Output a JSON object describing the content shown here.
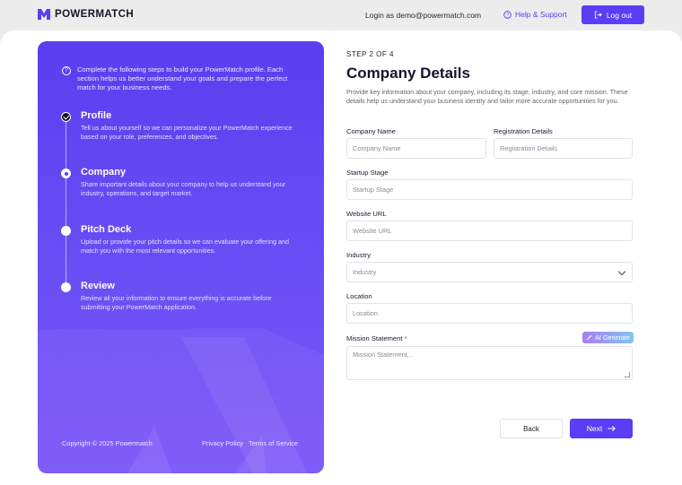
{
  "header": {
    "brand": "POWERMATCH",
    "login_prefix": "Login as",
    "login_email": "demo@powermatch.com",
    "help_label": "Help & Support",
    "logout_label": "Log out"
  },
  "colors": {
    "accent": "#5b3df5",
    "panel_top": "#5a3ef0",
    "panel_bottom": "#7a55f8"
  },
  "sidebar": {
    "intro": "Complete the following steps to build your PowerMatch profile. Each section helps us better understand your goals and prepare the perfect match for your business needs.",
    "steps": [
      {
        "title": "Profile",
        "desc": "Tell us about yourself so we can personalize your PowerMatch experience based on your role, preferences, and objectives.",
        "state": "completed"
      },
      {
        "title": "Company",
        "desc": "Share important details about your company to help us understand your industry, operations, and target market.",
        "state": "current"
      },
      {
        "title": "Pitch Deck",
        "desc": "Upload or provide your pitch details so we can evaluate your offering and match you with the most relevant opportunities.",
        "state": "upcoming"
      },
      {
        "title": "Review",
        "desc": "Review all your information to ensure everything is accurate before submitting your PowerMatch application.",
        "state": "upcoming"
      }
    ],
    "copyright": "Copyright © 2025 Powermatch",
    "privacy": "Privacy Policy",
    "terms": "Terms of Service"
  },
  "form": {
    "step_label": "STEP 2 OF 4",
    "title": "Company Details",
    "description": "Provide key information about your company, including its stage, industry, and core mission. These details help us understand your business identity and tailor more accurate opportunities for you.",
    "fields": {
      "company_name": {
        "label": "Company Name",
        "placeholder": "Company Name"
      },
      "registration": {
        "label": "Registration Details",
        "placeholder": "Registration Details"
      },
      "startup_stage": {
        "label": "Startup Stage",
        "placeholder": "Startup Stage"
      },
      "website": {
        "label": "Website URL",
        "placeholder": "Website URL"
      },
      "industry": {
        "label": "Industry",
        "placeholder": "Industry"
      },
      "location": {
        "label": "Location",
        "placeholder": "Location"
      },
      "mission": {
        "label": "Mission Statement",
        "required_mark": "*",
        "placeholder": "Mission Statement..."
      }
    },
    "ai_generate": "AI Generate",
    "back_label": "Back",
    "next_label": "Next"
  }
}
